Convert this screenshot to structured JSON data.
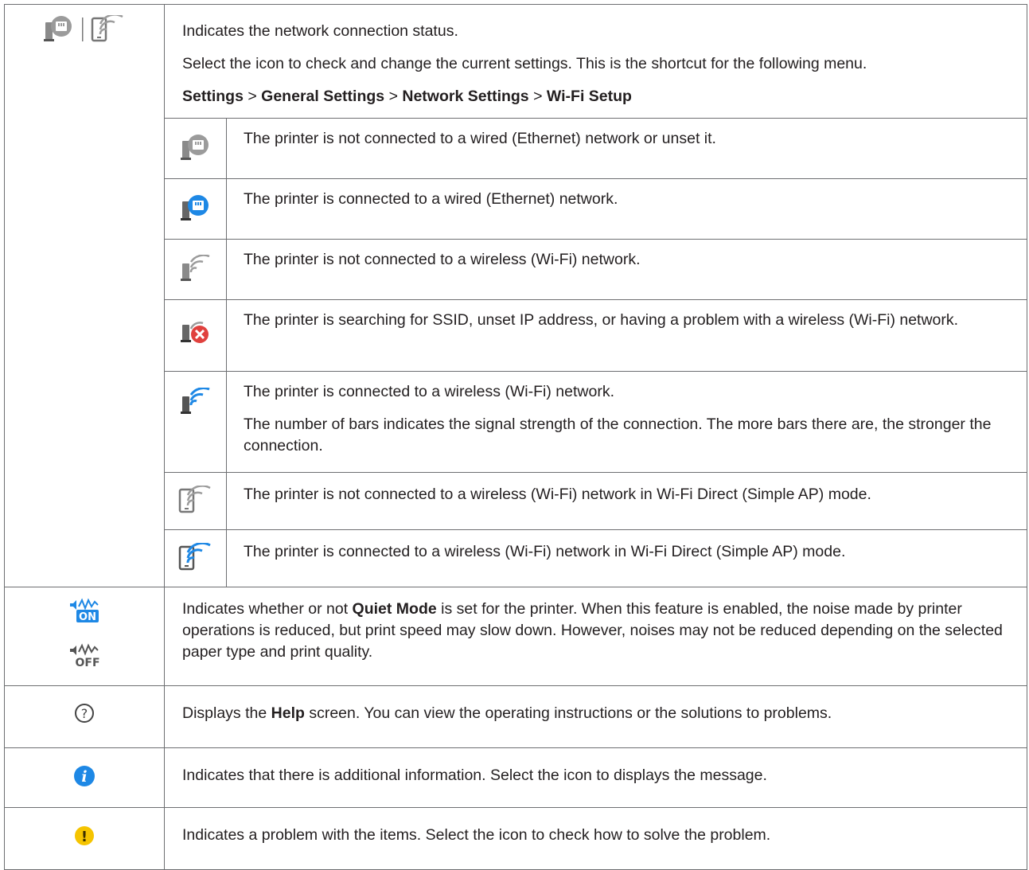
{
  "network": {
    "lines": [
      "Indicates the network connection status.",
      "Select the icon to check and change the current settings. This is the shortcut for the following menu."
    ],
    "path": [
      "Settings",
      "General Settings",
      "Network Settings",
      "Wi-Fi Setup"
    ],
    "path_sep": ">",
    "states": [
      {
        "icon": "ethernet-disconnected-icon",
        "text": "The printer is not connected to a wired (Ethernet) network or unset it."
      },
      {
        "icon": "ethernet-connected-icon",
        "text": "The printer is connected to a wired (Ethernet) network."
      },
      {
        "icon": "wifi-disconnected-icon",
        "text": "The printer is not connected to a wireless (Wi-Fi) network."
      },
      {
        "icon": "wifi-error-icon",
        "text": "The printer is searching for SSID, unset IP address, or having a problem with a wireless (Wi-Fi) network."
      },
      {
        "icon": "wifi-connected-icon",
        "text": "The printer is connected to a wireless (Wi-Fi) network.",
        "text2": "The number of bars indicates the signal strength of the connection. The more bars there are, the stronger the connection."
      },
      {
        "icon": "wifi-direct-disconnected-icon",
        "text": "The printer is not connected to a wireless (Wi-Fi) network in Wi-Fi Direct (Simple AP) mode."
      },
      {
        "icon": "wifi-direct-connected-icon",
        "text": "The printer is connected to a wireless (Wi-Fi) network in Wi-Fi Direct (Simple AP) mode."
      }
    ]
  },
  "quiet": {
    "pre": "Indicates whether or not ",
    "bold": "Quiet Mode",
    "post": " is set for the printer. When this feature is enabled, the noise made by printer operations is reduced, but print speed may slow down. However, noises may not be reduced depending on the selected paper type and print quality.",
    "on_label": "ON",
    "off_label": "OFF"
  },
  "help": {
    "pre": "Displays the ",
    "bold": "Help",
    "post": " screen. You can view the operating instructions or the solutions to problems.",
    "glyph": "?"
  },
  "info": {
    "text": "Indicates that there is additional information. Select the icon to displays the message.",
    "glyph": "i"
  },
  "warning": {
    "text": "Indicates a problem with the items. Select the icon to check how to solve the problem.",
    "glyph": "!"
  },
  "colors": {
    "border": "#6d6e71",
    "text": "#231f20",
    "blue": "#1e88e5",
    "gray_icon": "#8a8a8a",
    "error_red": "#e0413e",
    "warning_yellow": "#f5c400"
  }
}
